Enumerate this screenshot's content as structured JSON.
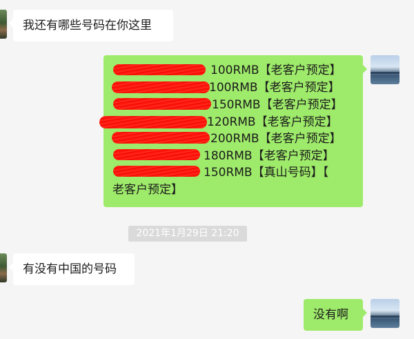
{
  "messages": [
    {
      "side": "left",
      "text": "我还有哪些号码在你这里"
    },
    {
      "side": "right",
      "lines": [
        "100RMB【老客户预定】",
        "100RMB【老客户预定】",
        "150RMB【老客户预定】",
        "120RMB【老客户预定】",
        "200RMB【老客户预定】",
        "180RMB【老客户预定】",
        "150RMB【真山号码】【",
        "老客户预定】"
      ]
    },
    {
      "side": "left",
      "text": "有没有中国的号码"
    },
    {
      "side": "right",
      "text": "没有啊"
    }
  ],
  "timestamp": "2021年1月29日 21:20",
  "colors": {
    "outgoing_bubble": "#9eea6a",
    "incoming_bubble": "#ffffff",
    "redaction": "#e8231c"
  },
  "avatars": {
    "left": "contact-avatar-photo",
    "right": "my-avatar-lake-photo"
  }
}
